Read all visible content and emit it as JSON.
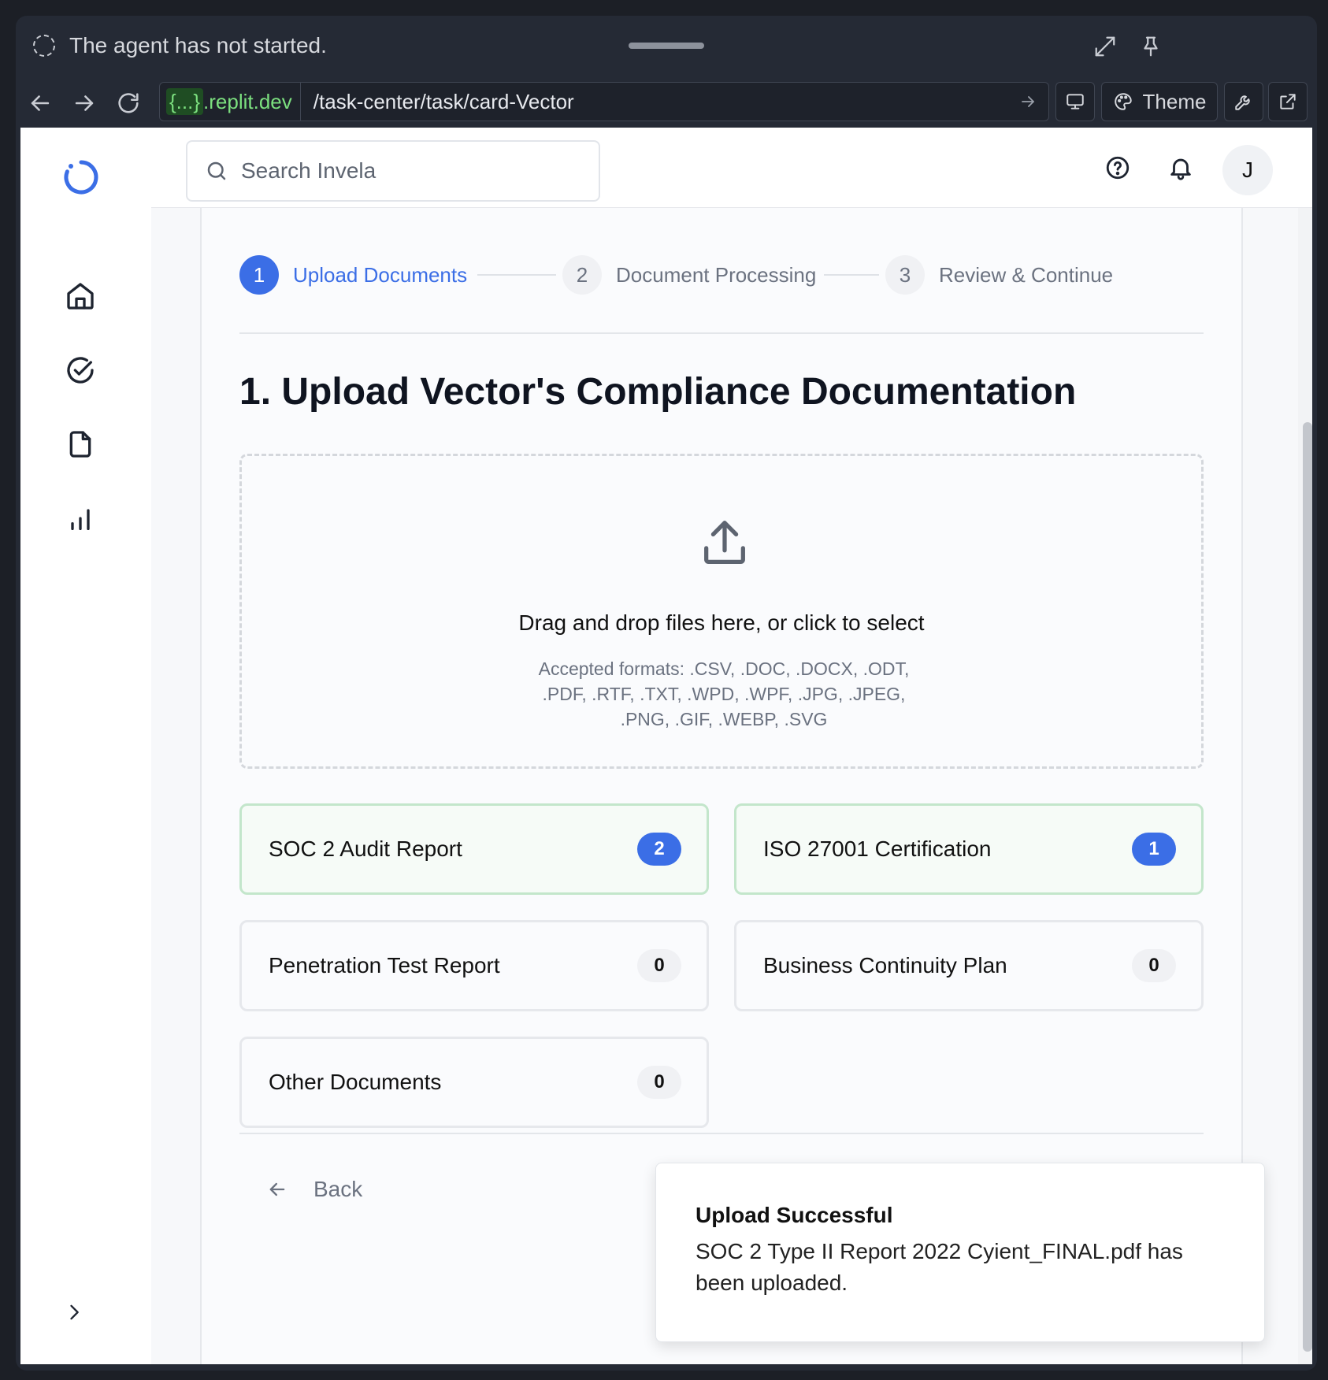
{
  "agent_bar": {
    "status": "The agent has not started."
  },
  "browser": {
    "url_domain_badge": "{...}",
    "url_domain_rest": ".replit.dev",
    "url_path": "/task-center/task/card-Vector",
    "theme_label": "Theme"
  },
  "header": {
    "search_placeholder": "Search Invela",
    "avatar_initial": "J"
  },
  "stepper": {
    "steps": [
      {
        "number": "1",
        "label": "Upload Documents",
        "state": "active"
      },
      {
        "number": "2",
        "label": "Document Processing",
        "state": "inactive"
      },
      {
        "number": "3",
        "label": "Review & Continue",
        "state": "inactive"
      }
    ]
  },
  "main": {
    "title": "1. Upload Vector's Compliance Documentation",
    "dropzone": {
      "title": "Drag and drop files here, or click to select",
      "formats": "Accepted formats: .CSV, .DOC, .DOCX, .ODT, .PDF, .RTF, .TXT, .WPD, .WPF, .JPG, .JPEG, .PNG, .GIF, .WEBP, .SVG"
    },
    "doc_categories": [
      {
        "label": "SOC 2 Audit Report",
        "count": "2"
      },
      {
        "label": "ISO 27001 Certification",
        "count": "1"
      },
      {
        "label": "Penetration Test Report",
        "count": "0"
      },
      {
        "label": "Business Continuity Plan",
        "count": "0"
      },
      {
        "label": "Other Documents",
        "count": "0"
      }
    ],
    "back_label": "Back"
  },
  "toast": {
    "title": "Upload Successful",
    "message": "SOC 2 Type II Report 2022 Cyient_FINAL.pdf has been uploaded."
  },
  "colors": {
    "accent": "#3b6ee6",
    "success_border": "#c3e6cb"
  }
}
